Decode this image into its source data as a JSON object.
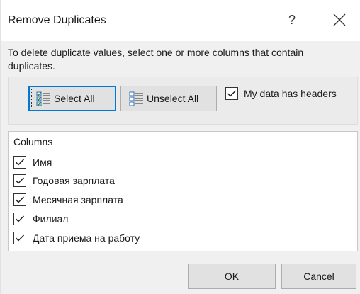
{
  "dialog": {
    "title": "Remove Duplicates",
    "help_label": "?",
    "instructions": "To delete duplicate values, select one or more columns that contain duplicates."
  },
  "buttons": {
    "select_all": {
      "pre": "Select ",
      "mnemonic": "A",
      "post": "ll"
    },
    "unselect_all": {
      "pre": "",
      "mnemonic": "U",
      "post": "nselect All"
    },
    "ok": "OK",
    "cancel": "Cancel"
  },
  "headers_option": {
    "mnemonic": "M",
    "label_rest": "y data has headers",
    "checked": true
  },
  "columns": {
    "title": "Columns",
    "items": [
      {
        "label": "Имя",
        "checked": true
      },
      {
        "label": "Годовая зарплата",
        "checked": true
      },
      {
        "label": "Месячная зарплата",
        "checked": true
      },
      {
        "label": "Филиал",
        "checked": true
      },
      {
        "label": "Дата приема на работу",
        "checked": true
      }
    ]
  },
  "colors": {
    "accent": "#0078d7",
    "background": "#f0f0f0",
    "button": "#e1e1e1"
  },
  "icons": [
    "help-icon",
    "close-icon",
    "select-all-icon",
    "unselect-all-icon",
    "checkmark-icon"
  ]
}
